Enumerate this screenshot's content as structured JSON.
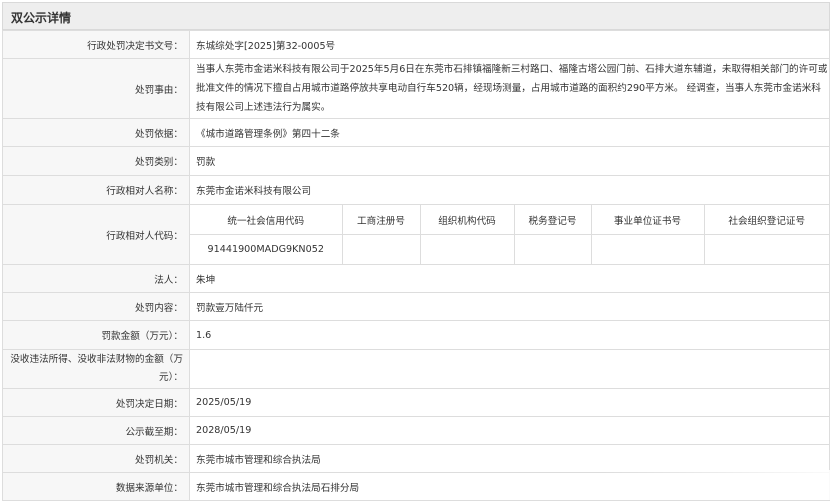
{
  "header": {
    "title": "双公示详情"
  },
  "rows": {
    "doc_number": {
      "label": "行政处罚决定书文号：",
      "value": "东城综处字[2025]第32-0005号"
    },
    "reason": {
      "label": "处罚事由：",
      "value": "当事人东莞市金诺米科技有限公司于2025年5月6日在东莞市石排镇福隆新三村路口、福隆古塔公园门前、石排大道东辅道，未取得相关部门的许可或批准文件的情况下擅自占用城市道路停放共享电动自行车520辆，经现场测量，占用城市道路的面积约290平方米。 经调查，当事人东莞市金诺米科技有限公司上述违法行为属实。"
    },
    "basis": {
      "label": "处罚依据：",
      "value": "《城市道路管理条例》第四十二条"
    },
    "category": {
      "label": "处罚类别：",
      "value": "罚款"
    },
    "counterpart_name": {
      "label": "行政相对人名称：",
      "value": "东莞市金诺米科技有限公司"
    },
    "counterpart_code": {
      "label": "行政相对人代码：",
      "headers": [
        "统一社会信用代码",
        "工商注册号",
        "组织机构代码",
        "税务登记号",
        "事业单位证书号",
        "社会组织登记证号"
      ],
      "values": [
        "91441900MADG9KN052",
        "",
        "",
        "",
        "",
        ""
      ]
    },
    "legal_rep": {
      "label": "法人：",
      "value": "朱坤"
    },
    "content": {
      "label": "处罚内容：",
      "value": "罚款壹万陆仟元"
    },
    "amount": {
      "label": "罚款金额（万元）：",
      "value": "1.6"
    },
    "confiscation": {
      "label": "没收违法所得、没收非法财物的金额（万元）：",
      "value": ""
    },
    "decision_date": {
      "label": "处罚决定日期：",
      "value": "2025/05/19"
    },
    "expiry_date": {
      "label": "公示截至期：",
      "value": "2028/05/19"
    },
    "authority": {
      "label": "处罚机关：",
      "value": "东莞市城市管理和综合执法局"
    },
    "source_unit": {
      "label": "数据来源单位：",
      "value": "东莞市城市管理和综合执法局石排分局"
    }
  }
}
